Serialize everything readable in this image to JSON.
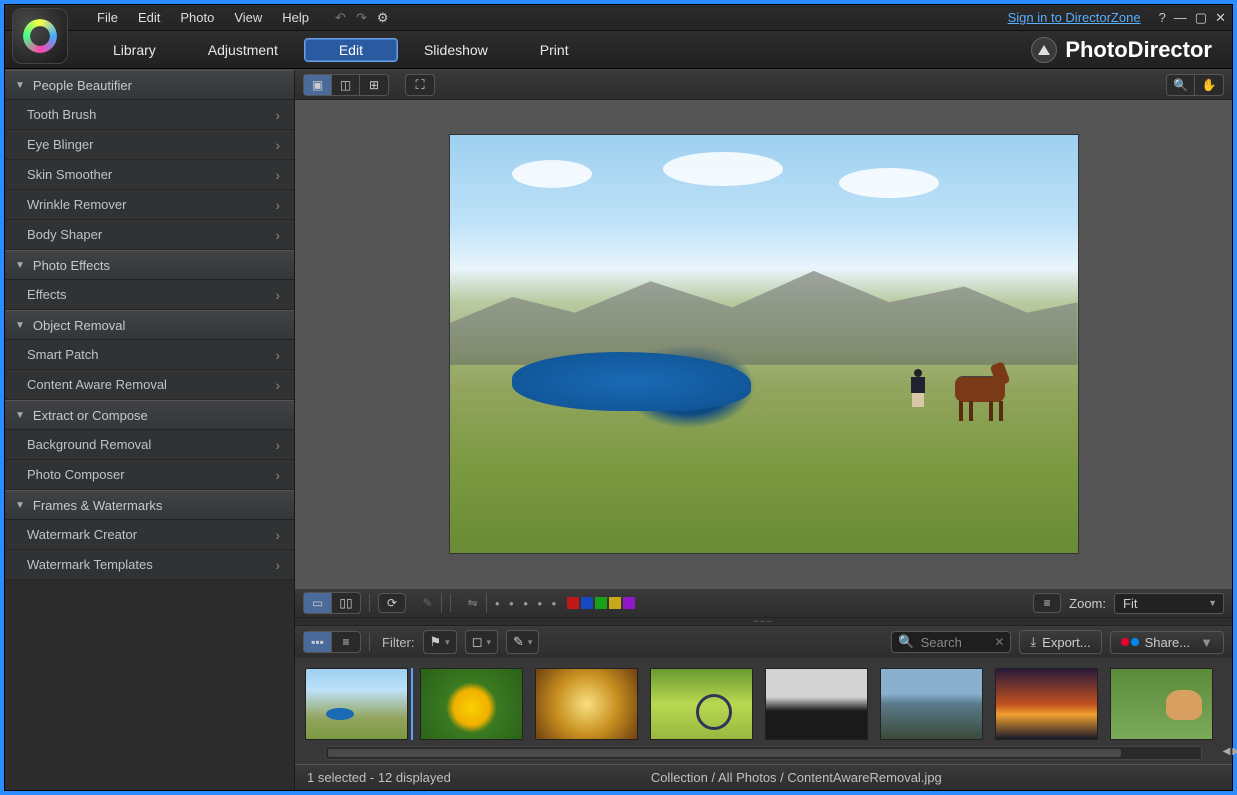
{
  "menu": [
    "File",
    "Edit",
    "Photo",
    "View",
    "Help"
  ],
  "signin": "Sign in to DirectorZone",
  "brand": "PhotoDirector",
  "tabs": [
    "Library",
    "Adjustment",
    "Edit",
    "Slideshow",
    "Print"
  ],
  "activeTab": "Edit",
  "sidebar": {
    "groups": [
      {
        "title": "People Beautifier",
        "items": [
          "Tooth Brush",
          "Eye Blinger",
          "Skin Smoother",
          "Wrinkle Remover",
          "Body Shaper"
        ]
      },
      {
        "title": "Photo Effects",
        "items": [
          "Effects"
        ]
      },
      {
        "title": "Object Removal",
        "items": [
          "Smart Patch",
          "Content Aware Removal"
        ]
      },
      {
        "title": "Extract or Compose",
        "items": [
          "Background Removal",
          "Photo Composer"
        ]
      },
      {
        "title": "Frames & Watermarks",
        "items": [
          "Watermark Creator",
          "Watermark Templates"
        ]
      }
    ]
  },
  "swatches": [
    "#c01818",
    "#1848c0",
    "#18a018",
    "#c8a818",
    "#9018c8"
  ],
  "zoom": {
    "label": "Zoom:",
    "value": "Fit"
  },
  "filter_label": "Filter:",
  "search_placeholder": "Search",
  "export_label": "Export...",
  "share_label": "Share...",
  "status": {
    "selection": "1 selected - 12 displayed",
    "path": "Collection / All Photos / ContentAwareRemoval.jpg"
  }
}
